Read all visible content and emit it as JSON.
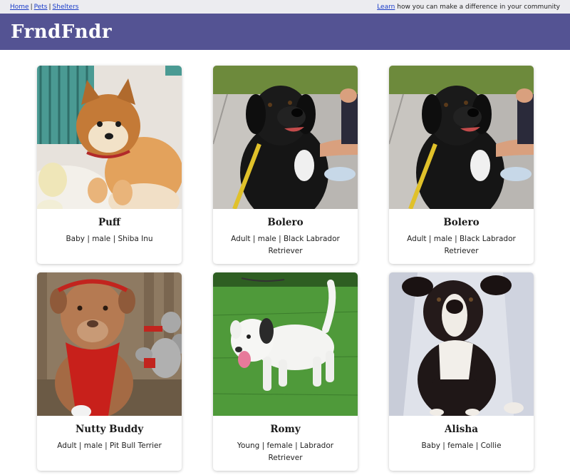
{
  "topnav": {
    "links": [
      "Home",
      "Pets",
      "Shelters"
    ],
    "separator": "|",
    "learn_link": "Learn",
    "learn_text": "how you can make a difference in your community"
  },
  "header": {
    "brand": "FrndFndr"
  },
  "pets": [
    {
      "name": "Puff",
      "details": "Baby | male | Shiba Inu"
    },
    {
      "name": "Bolero",
      "details": "Adult | male | Black Labrador Retriever"
    },
    {
      "name": "Bolero",
      "details": "Adult | male | Black Labrador Retriever"
    },
    {
      "name": "Nutty Buddy",
      "details": "Adult | male | Pit Bull Terrier"
    },
    {
      "name": "Romy",
      "details": "Young | female | Labrador Retriever"
    },
    {
      "name": "Alisha",
      "details": "Baby | female | Collie"
    }
  ]
}
